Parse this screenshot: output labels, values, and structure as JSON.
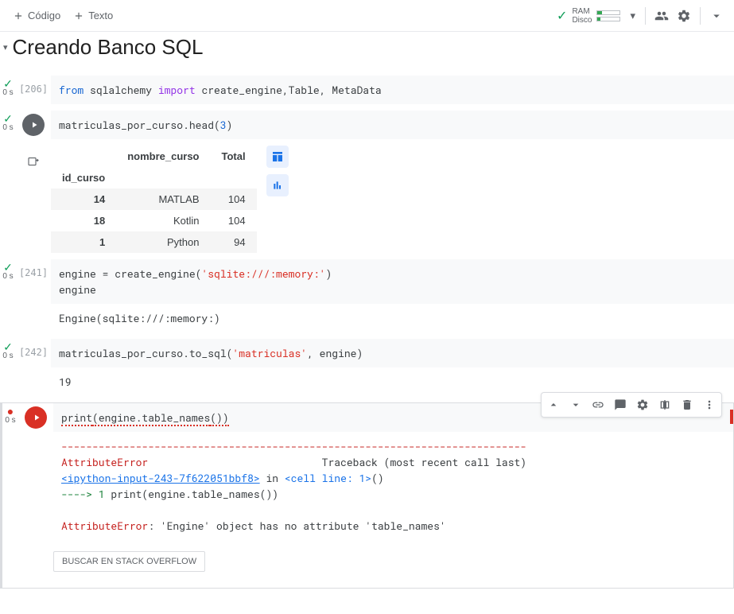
{
  "toolbar": {
    "codigo": "Código",
    "texto": "Texto"
  },
  "resources": {
    "ram": "RAM",
    "disco": "Disco"
  },
  "section_title": "Creando Banco SQL",
  "cells": [
    {
      "exec_count": "[206]",
      "time": "0 s",
      "code_tokens": [
        [
          "kw-blue",
          "from"
        ],
        [
          "",
          ".sqlalchemy."
        ],
        [
          "kw-purple",
          "import"
        ],
        [
          "",
          " create_engine,Table, MetaData"
        ]
      ]
    },
    {
      "exec_count": "[ ]",
      "time": "0 s",
      "code_plain": "matriculas_por_curso.head(3)",
      "df": {
        "index_name": "id_curso",
        "columns": [
          "nombre_curso",
          "Total"
        ],
        "rows": [
          {
            "idx": "14",
            "nombre_curso": "MATLAB",
            "Total": "104"
          },
          {
            "idx": "18",
            "nombre_curso": "Kotlin",
            "Total": "104"
          },
          {
            "idx": "1",
            "nombre_curso": "Python",
            "Total": "94"
          }
        ]
      }
    },
    {
      "exec_count": "[241]",
      "time": "0 s",
      "code_html": "engine = create_engine(<span class='kw-str2'>'sqlite:///:memory:'</span>)\nengine",
      "output_text": "Engine(sqlite:///:memory:)"
    },
    {
      "exec_count": "[242]",
      "time": "0 s",
      "code_html": "matriculas_por_curso.to_sql(<span class='kw-str2'>'matriculas'</span>, engine)",
      "output_text": "19"
    },
    {
      "exec_count": "",
      "time": "0 s",
      "code_html": "<span class='underline-red'>print(engine.table_names())</span>",
      "traceback": {
        "dash": "---------------------------------------------------------------------------",
        "err1": "AttributeError",
        "trace_lbl": "Traceback (most recent call last)",
        "link": "<ipython-input-243-7f622051bbf8>",
        "in": " in ",
        "cellline": "<cell line: 1>",
        "paren": "()",
        "arrow": "----> 1 print(engine.table_names())",
        "err2a": "AttributeError",
        "err2b": ": 'Engine' object has no attribute 'table_names'"
      },
      "stack_btn": "BUSCAR EN STACK OVERFLOW"
    }
  ]
}
